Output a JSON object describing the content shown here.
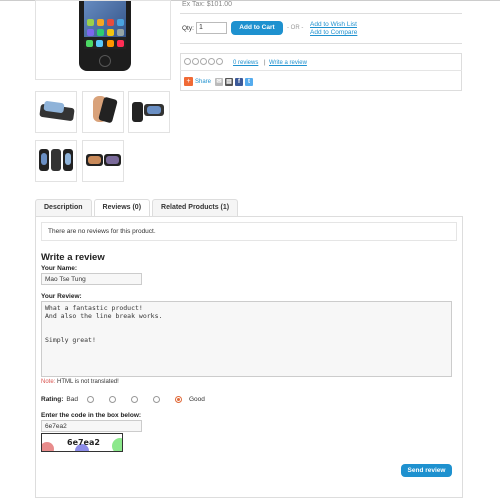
{
  "product": {
    "ex_tax": "Ex Tax: $101.00",
    "qty_label": "Qty:",
    "qty_value": "1",
    "add_to_cart": "Add to Cart",
    "or": "- OR -",
    "wish_list": "Add to Wish List",
    "compare": "Add to Compare"
  },
  "rating_summary": {
    "stars": 0,
    "reviews_link": "0 reviews",
    "separator": "|",
    "write_review": "Write a review",
    "share_label": "Share"
  },
  "tabs": [
    {
      "label": "Description",
      "active": false
    },
    {
      "label": "Reviews (0)",
      "active": true
    },
    {
      "label": "Related Products (1)",
      "active": false
    }
  ],
  "reviews": {
    "no_reviews": "There are no reviews for this product.",
    "title": "Write a review",
    "name_label": "Your Name:",
    "name_value": "Mao Tse Tung",
    "review_label": "Your Review:",
    "review_value": "What a fantastic product!\nAnd also the line break works.\n\n\nSimply great!",
    "note_prefix": "Note:",
    "note_text": " HTML is not translated!",
    "rating_label": "Rating:",
    "bad": "Bad",
    "good": "Good",
    "selected_rating": 5,
    "captcha_label": "Enter the code in the box below:",
    "captcha_value": "6e7ea2",
    "captcha_image_text": "6e7ea2",
    "send": "Send review"
  },
  "colors": {
    "accent": "#1e91cf",
    "note_red": "#d9534f",
    "radio_checked": "#e06a3a"
  }
}
